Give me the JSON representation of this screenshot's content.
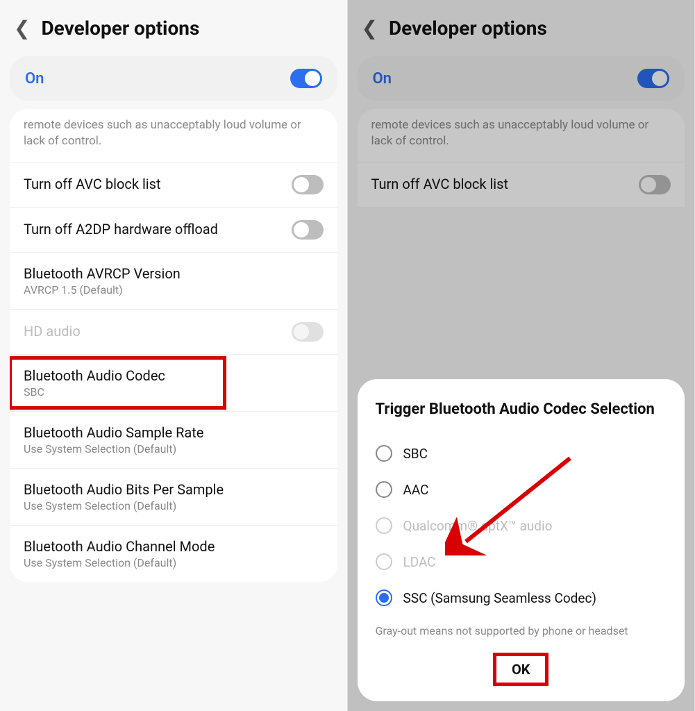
{
  "left": {
    "header": {
      "title": "Developer options"
    },
    "on_card": {
      "label": "On",
      "state": "on"
    },
    "desc": "remote devices such as unacceptably loud volume or lack of control.",
    "rows": [
      {
        "title": "Turn off AVC block list",
        "sub": "",
        "toggle": "off"
      },
      {
        "title": "Turn off A2DP hardware offload",
        "sub": "",
        "toggle": "off"
      },
      {
        "title": "Bluetooth AVRCP Version",
        "sub": "AVRCP 1.5 (Default)"
      },
      {
        "title": "HD audio",
        "sub": "",
        "toggle": "disabled",
        "disabled": true
      },
      {
        "title": "Bluetooth Audio Codec",
        "sub": "SBC",
        "highlighted": true
      },
      {
        "title": "Bluetooth Audio Sample Rate",
        "sub": "Use System Selection (Default)"
      },
      {
        "title": "Bluetooth Audio Bits Per Sample",
        "sub": "Use System Selection (Default)"
      },
      {
        "title": "Bluetooth Audio Channel Mode",
        "sub": "Use System Selection (Default)"
      }
    ]
  },
  "right": {
    "header": {
      "title": "Developer options"
    },
    "on_card": {
      "label": "On",
      "state": "on"
    },
    "desc": "remote devices such as unacceptably loud volume or lack of control.",
    "rows": [
      {
        "title": "Turn off AVC block list",
        "sub": "",
        "toggle": "off"
      }
    ],
    "dialog": {
      "title": "Trigger Bluetooth Audio Codec Selection",
      "options": [
        {
          "label": "SBC",
          "selected": false,
          "disabled": false
        },
        {
          "label": "AAC",
          "selected": false,
          "disabled": false
        },
        {
          "label": "Qualcomm® aptX™ audio",
          "selected": false,
          "disabled": true
        },
        {
          "label": "LDAC",
          "selected": false,
          "disabled": true
        },
        {
          "label": "SSC (Samsung Seamless Codec)",
          "selected": true,
          "disabled": false
        }
      ],
      "note": "Gray-out means not supported by phone or headset",
      "ok": "OK"
    }
  },
  "colors": {
    "accent": "#2b6ef0",
    "highlight": "#d80000"
  }
}
